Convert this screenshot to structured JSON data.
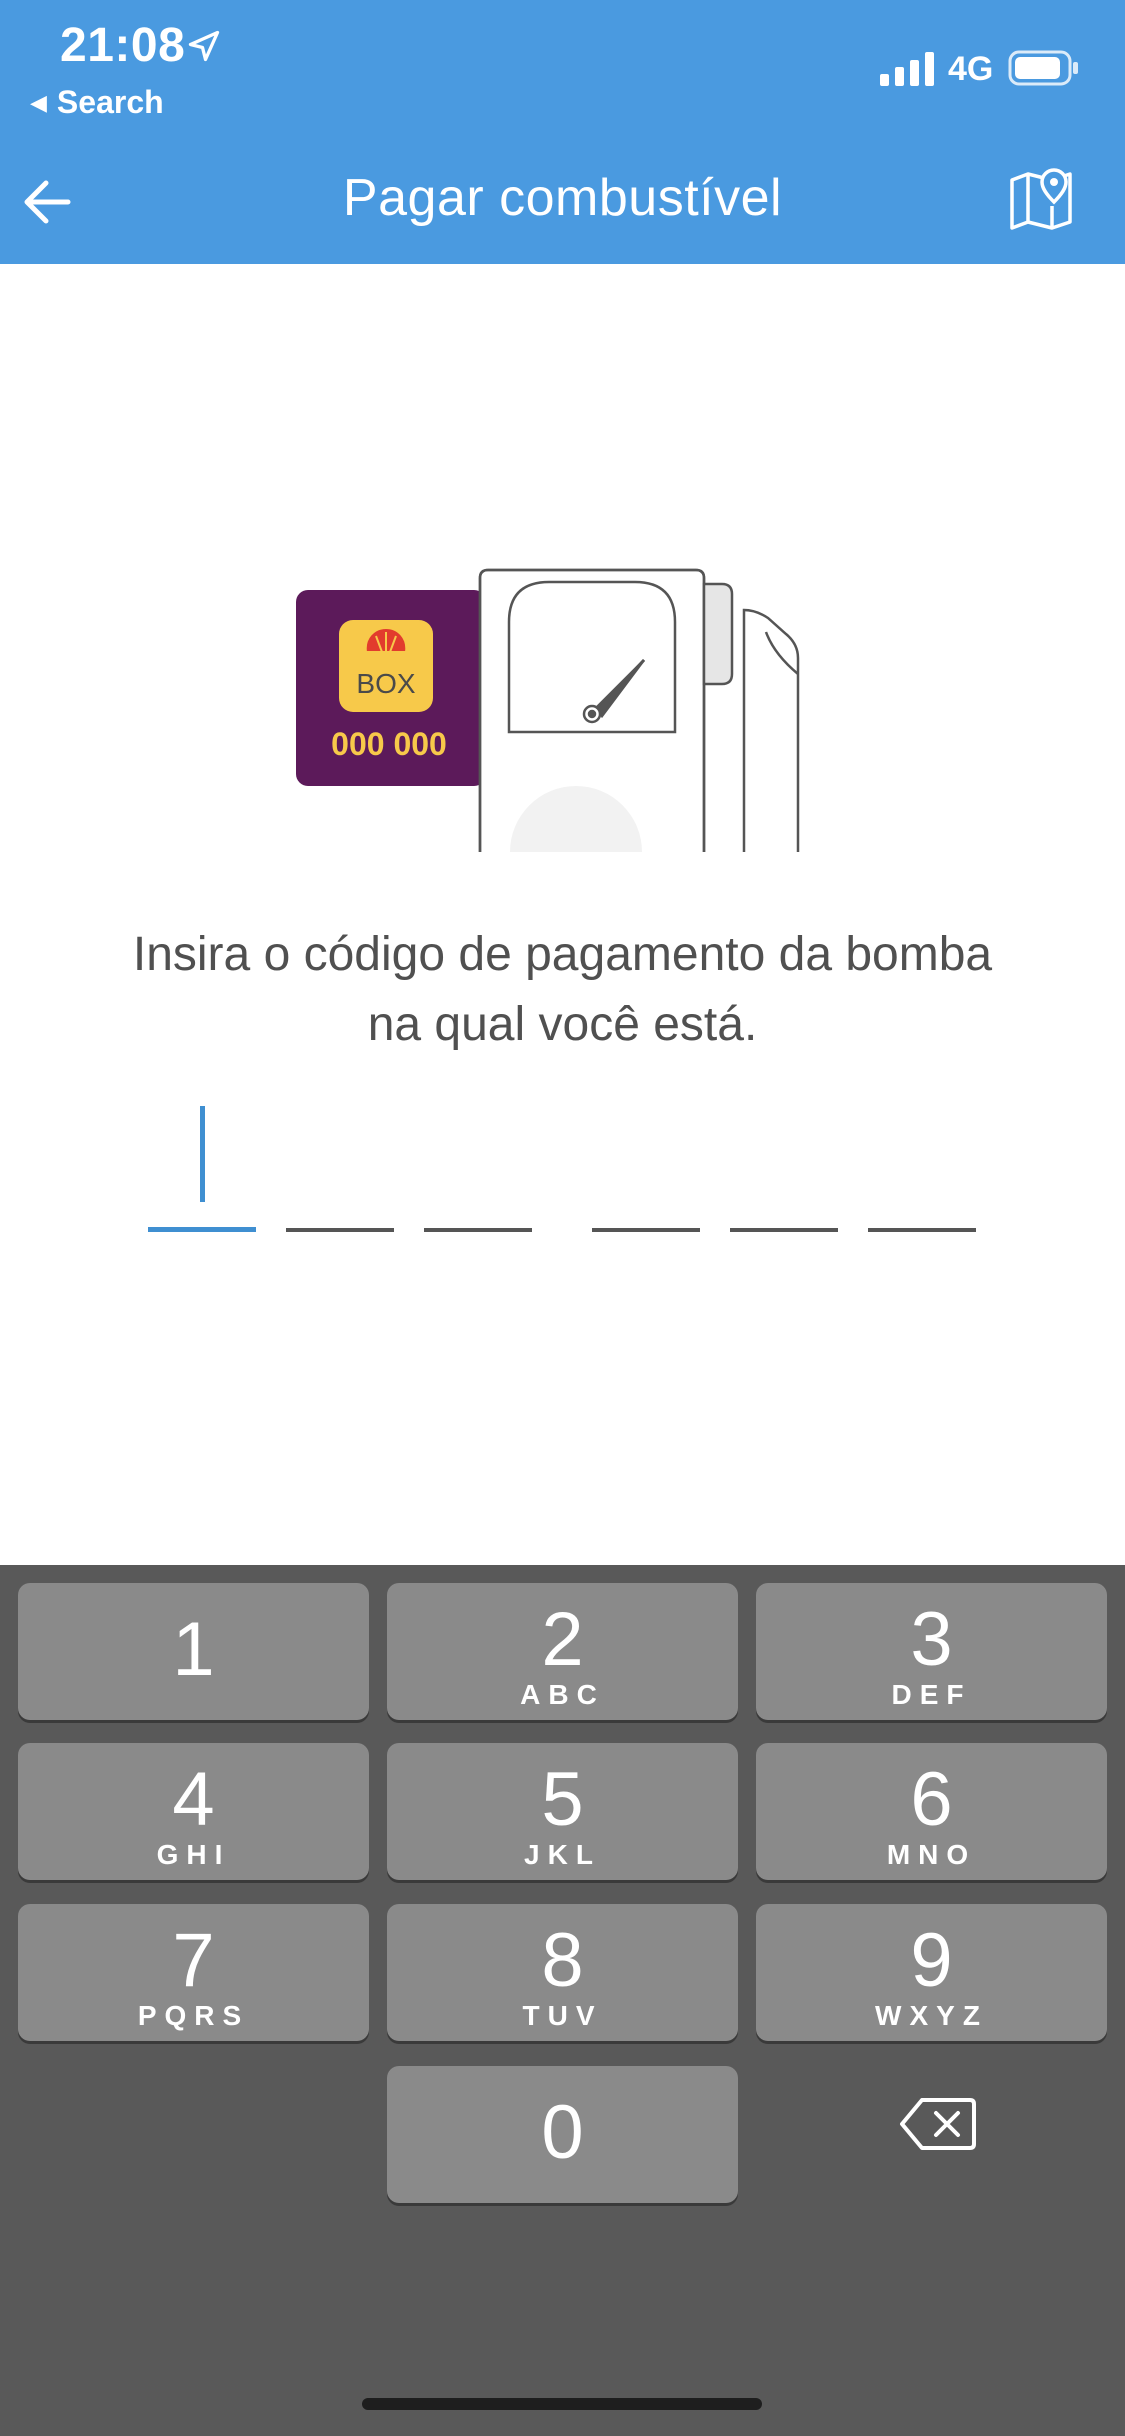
{
  "status_bar": {
    "time": "21:08",
    "back_app": "Search",
    "network": "4G"
  },
  "header": {
    "title": "Pagar combustível",
    "back_icon": "arrow-left-icon",
    "map_icon": "map-pin-icon"
  },
  "illustration": {
    "card_brand": "BOX",
    "card_code": "000 000"
  },
  "instruction": {
    "line1": "Insira o código de pagamento da bomba",
    "line2": "na qual você está."
  },
  "code_input": {
    "slots": 6,
    "active_index": 0
  },
  "keypad": {
    "keys": [
      {
        "digit": "1",
        "letters": ""
      },
      {
        "digit": "2",
        "letters": "ABC"
      },
      {
        "digit": "3",
        "letters": "DEF"
      },
      {
        "digit": "4",
        "letters": "GHI"
      },
      {
        "digit": "5",
        "letters": "JKL"
      },
      {
        "digit": "6",
        "letters": "MNO"
      },
      {
        "digit": "7",
        "letters": "PQRS"
      },
      {
        "digit": "8",
        "letters": "TUV"
      },
      {
        "digit": "9",
        "letters": "WXYZ"
      },
      {
        "digit": "0",
        "letters": ""
      }
    ],
    "backspace_icon": "backspace-icon"
  },
  "colors": {
    "header": "#4a9ae0",
    "accent": "#3f8fd1",
    "card": "#5c1a5a",
    "card_text": "#f7c94a"
  }
}
